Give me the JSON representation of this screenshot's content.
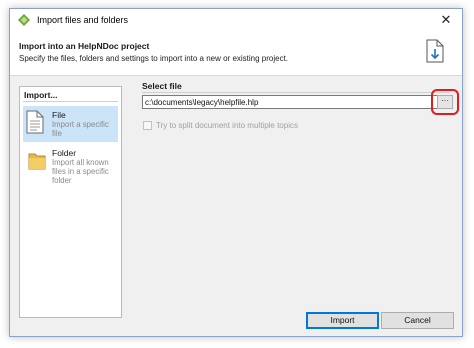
{
  "window": {
    "title": "Import files and folders",
    "close_glyph": "✕"
  },
  "header": {
    "title": "Import into an HelpNDoc project",
    "subtitle": "Specify the files, folders and settings to import into a new or existing project."
  },
  "import_panel": {
    "heading": "Import...",
    "items": [
      {
        "title": "File",
        "description": "Import a specific file",
        "icon": "file-icon",
        "selected": true
      },
      {
        "title": "Folder",
        "description": "Import all known files in a specific folder",
        "icon": "folder-icon",
        "selected": false
      }
    ]
  },
  "select_file": {
    "heading": "Select file",
    "path_value": "c:\\documents\\legacy\\helpfile.hlp",
    "browse_label": "···",
    "split_label": "Try to split document into multiple topics",
    "split_checked": false
  },
  "buttons": {
    "import_label": "Import",
    "cancel_label": "Cancel"
  },
  "colors": {
    "accent_selected": "#cce4f7",
    "highlight_ring": "#e41b1b",
    "default_button_border": "#0078d7"
  }
}
